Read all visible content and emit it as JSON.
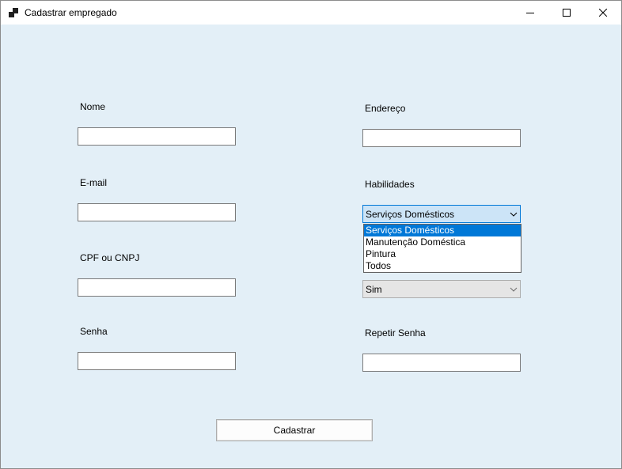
{
  "window": {
    "title": "Cadastrar empregado",
    "controls": {
      "minimize": "minimize-icon",
      "maximize": "maximize-icon",
      "close": "close-icon"
    }
  },
  "form": {
    "nome_label": "Nome",
    "nome_value": "",
    "email_label": "E-mail",
    "email_value": "",
    "cpf_label": "CPF ou CNPJ",
    "cpf_value": "",
    "senha_label": "Senha",
    "senha_value": "",
    "endereco_label": "Endereço",
    "endereco_value": "",
    "habilidades_label": "Habilidades",
    "habilidades_selected": "Serviços Domésticos",
    "habilidades_options": [
      "Serviços Domésticos",
      "Manutenção Doméstica",
      "Pintura",
      "Todos"
    ],
    "second_combo_selected": "Sim",
    "repetir_senha_label": "Repetir Senha",
    "repetir_senha_value": "",
    "submit_label": "Cadastrar"
  },
  "colors": {
    "form_background": "#e3eff7",
    "selection": "#0078d7",
    "combo_focus": "#cce4f7"
  }
}
